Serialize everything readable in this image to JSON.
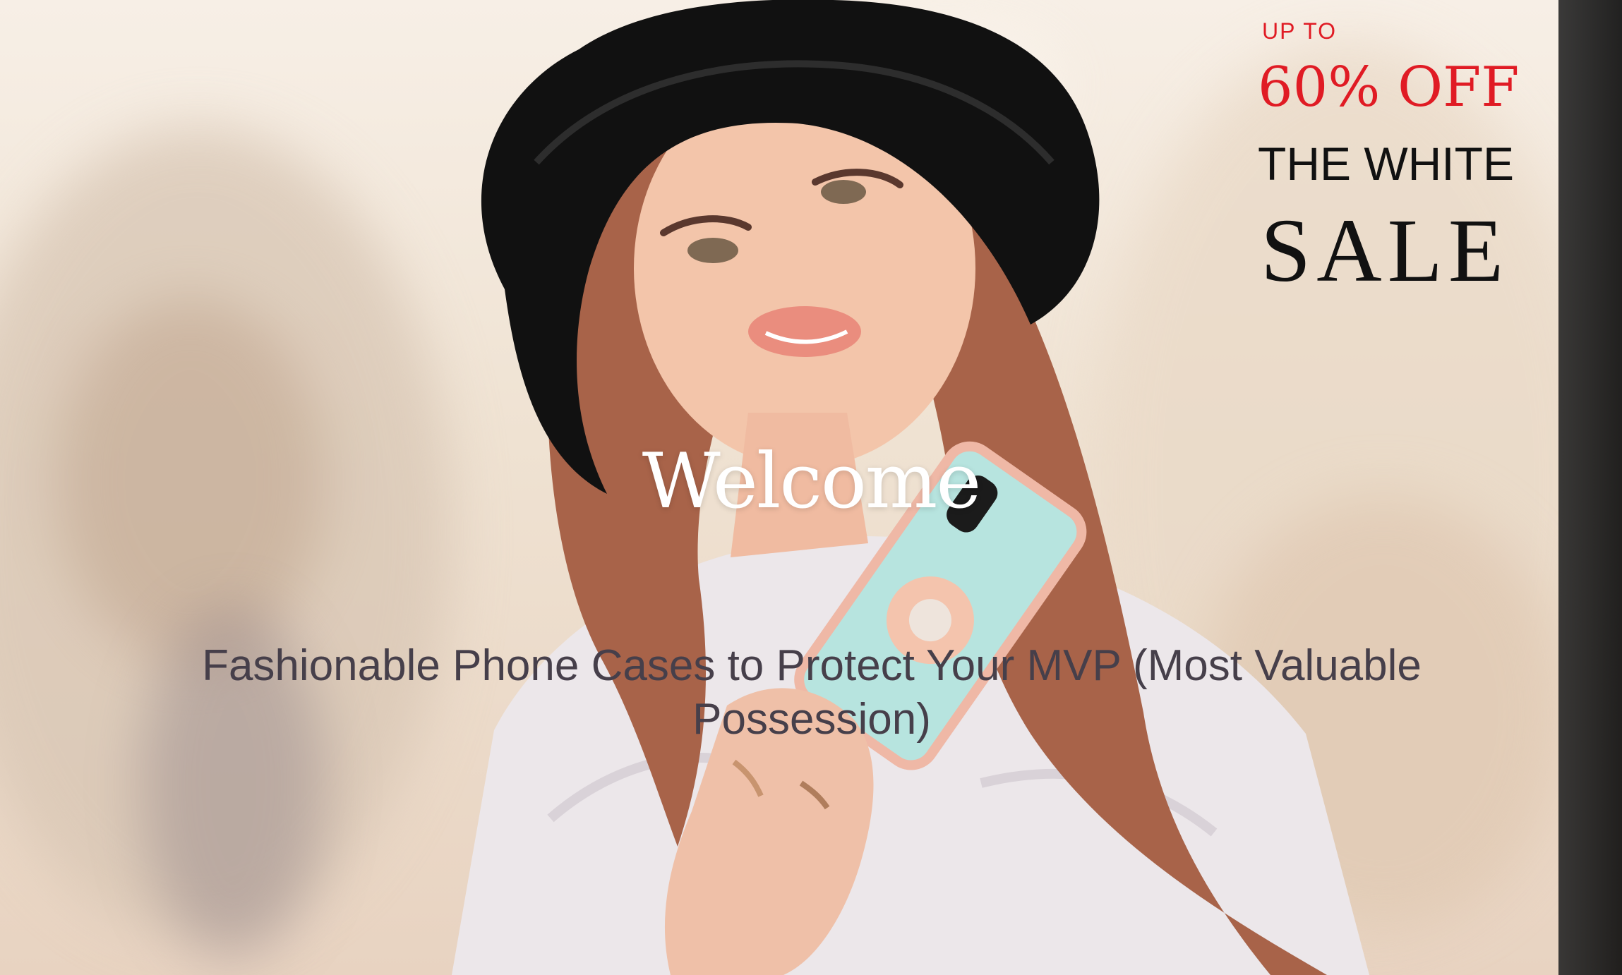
{
  "hero": {
    "welcome_text": "Welcome",
    "tagline": "Fashionable Phone Cases to Protect Your MVP (Most Valuable Possession)"
  },
  "promo": {
    "up_to": "UP TO",
    "discount": "60% OFF",
    "line1": "THE WHITE",
    "line2": "SALE"
  },
  "colors": {
    "promo_accent": "#e01b24",
    "promo_text": "#111111",
    "tagline": "#463f4a",
    "welcome": "#ffffff"
  }
}
